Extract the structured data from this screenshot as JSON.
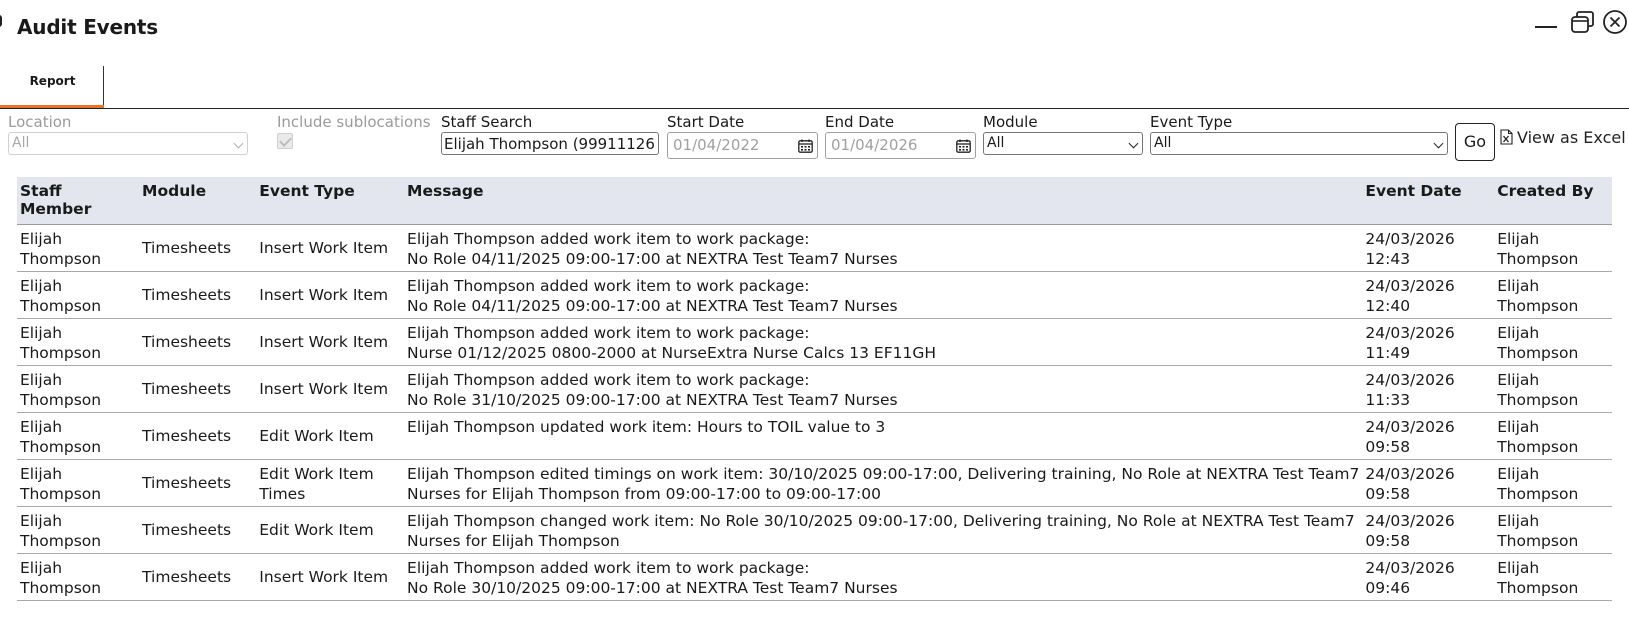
{
  "window": {
    "title": "Audit Events"
  },
  "tabs": [
    {
      "label": "Report",
      "active": true
    }
  ],
  "accent_color": "#e8742a",
  "filters": {
    "location": {
      "label": "Location",
      "value": "All",
      "disabled": true
    },
    "include_sublocations": {
      "label": "Include sublocations",
      "checked": true,
      "disabled": true
    },
    "staff_search": {
      "label": "Staff Search",
      "value": "Elijah Thompson (99911126"
    },
    "start_date": {
      "label": "Start Date",
      "value": "01/04/2022"
    },
    "end_date": {
      "label": "End Date",
      "value": "01/04/2026"
    },
    "module": {
      "label": "Module",
      "value": "All"
    },
    "event_type": {
      "label": "Event Type",
      "value": "All"
    },
    "go_label": "Go",
    "excel_label": "View as Excel"
  },
  "table": {
    "columns": [
      "Staff Member",
      "Module",
      "Event Type",
      "Message",
      "Event Date",
      "Created By"
    ],
    "rows": [
      {
        "staff": [
          "Elijah",
          "Thompson"
        ],
        "module": "Timesheets",
        "event_type": [
          "Insert Work Item"
        ],
        "message": [
          "Elijah Thompson added work item to work package:",
          "No Role 04/11/2025 09:00-17:00 at NEXTRA Test Team7 Nurses"
        ],
        "event_date": [
          "24/03/2026",
          "12:43"
        ],
        "created_by": [
          "Elijah",
          "Thompson"
        ]
      },
      {
        "staff": [
          "Elijah",
          "Thompson"
        ],
        "module": "Timesheets",
        "event_type": [
          "Insert Work Item"
        ],
        "message": [
          "Elijah Thompson added work item to work package:",
          "No Role 04/11/2025 09:00-17:00 at NEXTRA Test Team7 Nurses"
        ],
        "event_date": [
          "24/03/2026",
          "12:40"
        ],
        "created_by": [
          "Elijah",
          "Thompson"
        ]
      },
      {
        "staff": [
          "Elijah",
          "Thompson"
        ],
        "module": "Timesheets",
        "event_type": [
          "Insert Work Item"
        ],
        "message": [
          "Elijah Thompson added work item to work package:",
          "Nurse 01/12/2025 0800-2000 at NurseExtra Nurse Calcs 13 EF11GH"
        ],
        "event_date": [
          "24/03/2026",
          "11:49"
        ],
        "created_by": [
          "Elijah",
          "Thompson"
        ]
      },
      {
        "staff": [
          "Elijah",
          "Thompson"
        ],
        "module": "Timesheets",
        "event_type": [
          "Insert Work Item"
        ],
        "message": [
          "Elijah Thompson added work item to work package:",
          "No Role 31/10/2025 09:00-17:00 at NEXTRA Test Team7 Nurses"
        ],
        "event_date": [
          "24/03/2026",
          "11:33"
        ],
        "created_by": [
          "Elijah",
          "Thompson"
        ]
      },
      {
        "staff": [
          "Elijah",
          "Thompson"
        ],
        "module": "Timesheets",
        "event_type": [
          "Edit Work Item"
        ],
        "message": [
          "Elijah Thompson updated work item: Hours to TOIL value to 3"
        ],
        "event_date": [
          "24/03/2026",
          "09:58"
        ],
        "created_by": [
          "Elijah",
          "Thompson"
        ]
      },
      {
        "staff": [
          "Elijah",
          "Thompson"
        ],
        "module": "Timesheets",
        "event_type": [
          "Edit Work Item",
          "Times"
        ],
        "message": [
          "Elijah Thompson edited timings on work item: 30/10/2025 09:00-17:00, Delivering training, No Role at NEXTRA Test Team7",
          "Nurses for Elijah Thompson from 09:00-17:00 to 09:00-17:00"
        ],
        "event_date": [
          "24/03/2026",
          "09:58"
        ],
        "created_by": [
          "Elijah",
          "Thompson"
        ]
      },
      {
        "staff": [
          "Elijah",
          "Thompson"
        ],
        "module": "Timesheets",
        "event_type": [
          "Edit Work Item"
        ],
        "message": [
          "Elijah Thompson changed work item: No Role 30/10/2025 09:00-17:00, Delivering training, No Role at NEXTRA Test Team7",
          "Nurses for Elijah Thompson"
        ],
        "event_date": [
          "24/03/2026",
          "09:58"
        ],
        "created_by": [
          "Elijah",
          "Thompson"
        ]
      },
      {
        "staff": [
          "Elijah",
          "Thompson"
        ],
        "module": "Timesheets",
        "event_type": [
          "Insert Work Item"
        ],
        "message": [
          "Elijah Thompson added work item to work package:",
          "No Role 30/10/2025 09:00-17:00 at NEXTRA Test Team7 Nurses"
        ],
        "event_date": [
          "24/03/2026",
          "09:46"
        ],
        "created_by": [
          "Elijah",
          "Thompson"
        ]
      }
    ]
  }
}
